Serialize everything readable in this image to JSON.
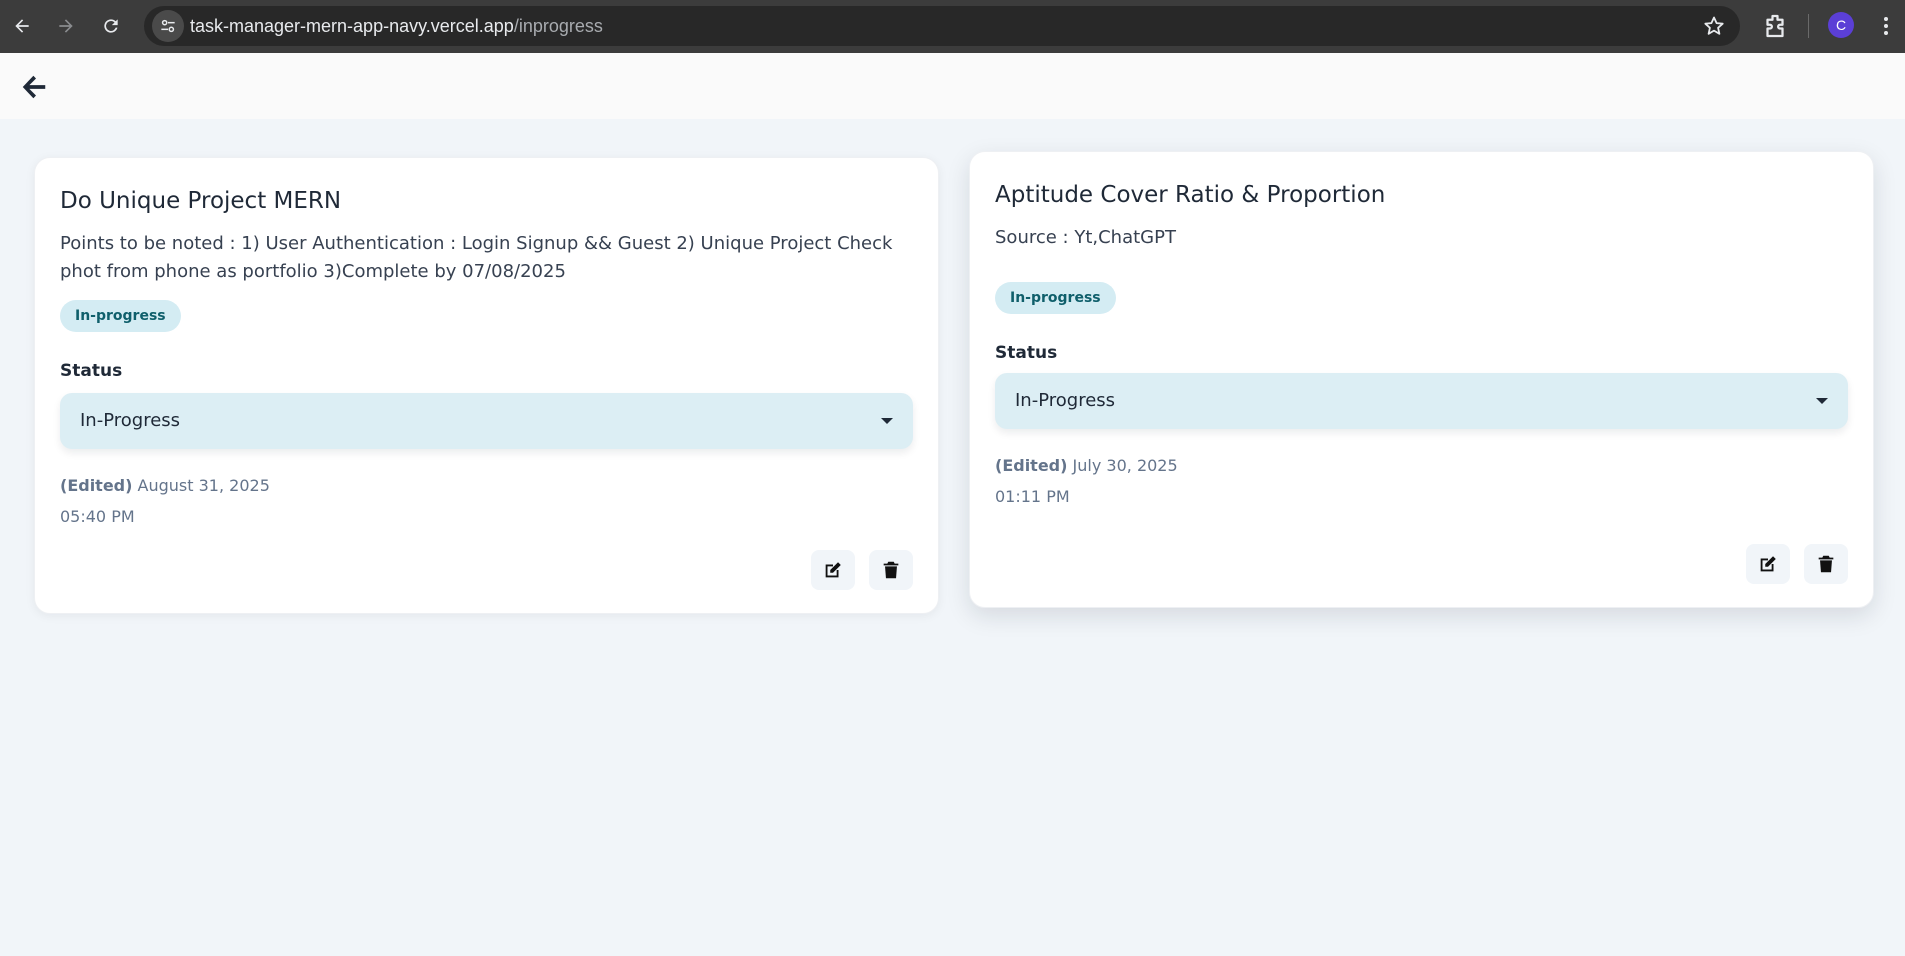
{
  "browser": {
    "url_host": "task-manager-mern-app-navy.vercel.app",
    "url_path": "/inprogress",
    "profile_initial": "C"
  },
  "cards": [
    {
      "title": "Do Unique Project MERN",
      "description": "Points to be noted : 1) User Authentication : Login Signup && Guest 2) Unique Project Check phot from phone as portfolio 3)Complete by 07/08/2025",
      "badge": "In-progress",
      "status_label": "Status",
      "status_value": "In-Progress",
      "edited_prefix": "(Edited)",
      "edited_date": "August 31, 2025",
      "edited_time": "05:40 PM"
    },
    {
      "title": "Aptitude Cover Ratio & Proportion",
      "description": "Source : Yt,ChatGPT",
      "badge": "In-progress",
      "status_label": "Status",
      "status_value": "In-Progress",
      "edited_prefix": "(Edited)",
      "edited_date": "July 30, 2025",
      "edited_time": "01:11 PM"
    }
  ]
}
